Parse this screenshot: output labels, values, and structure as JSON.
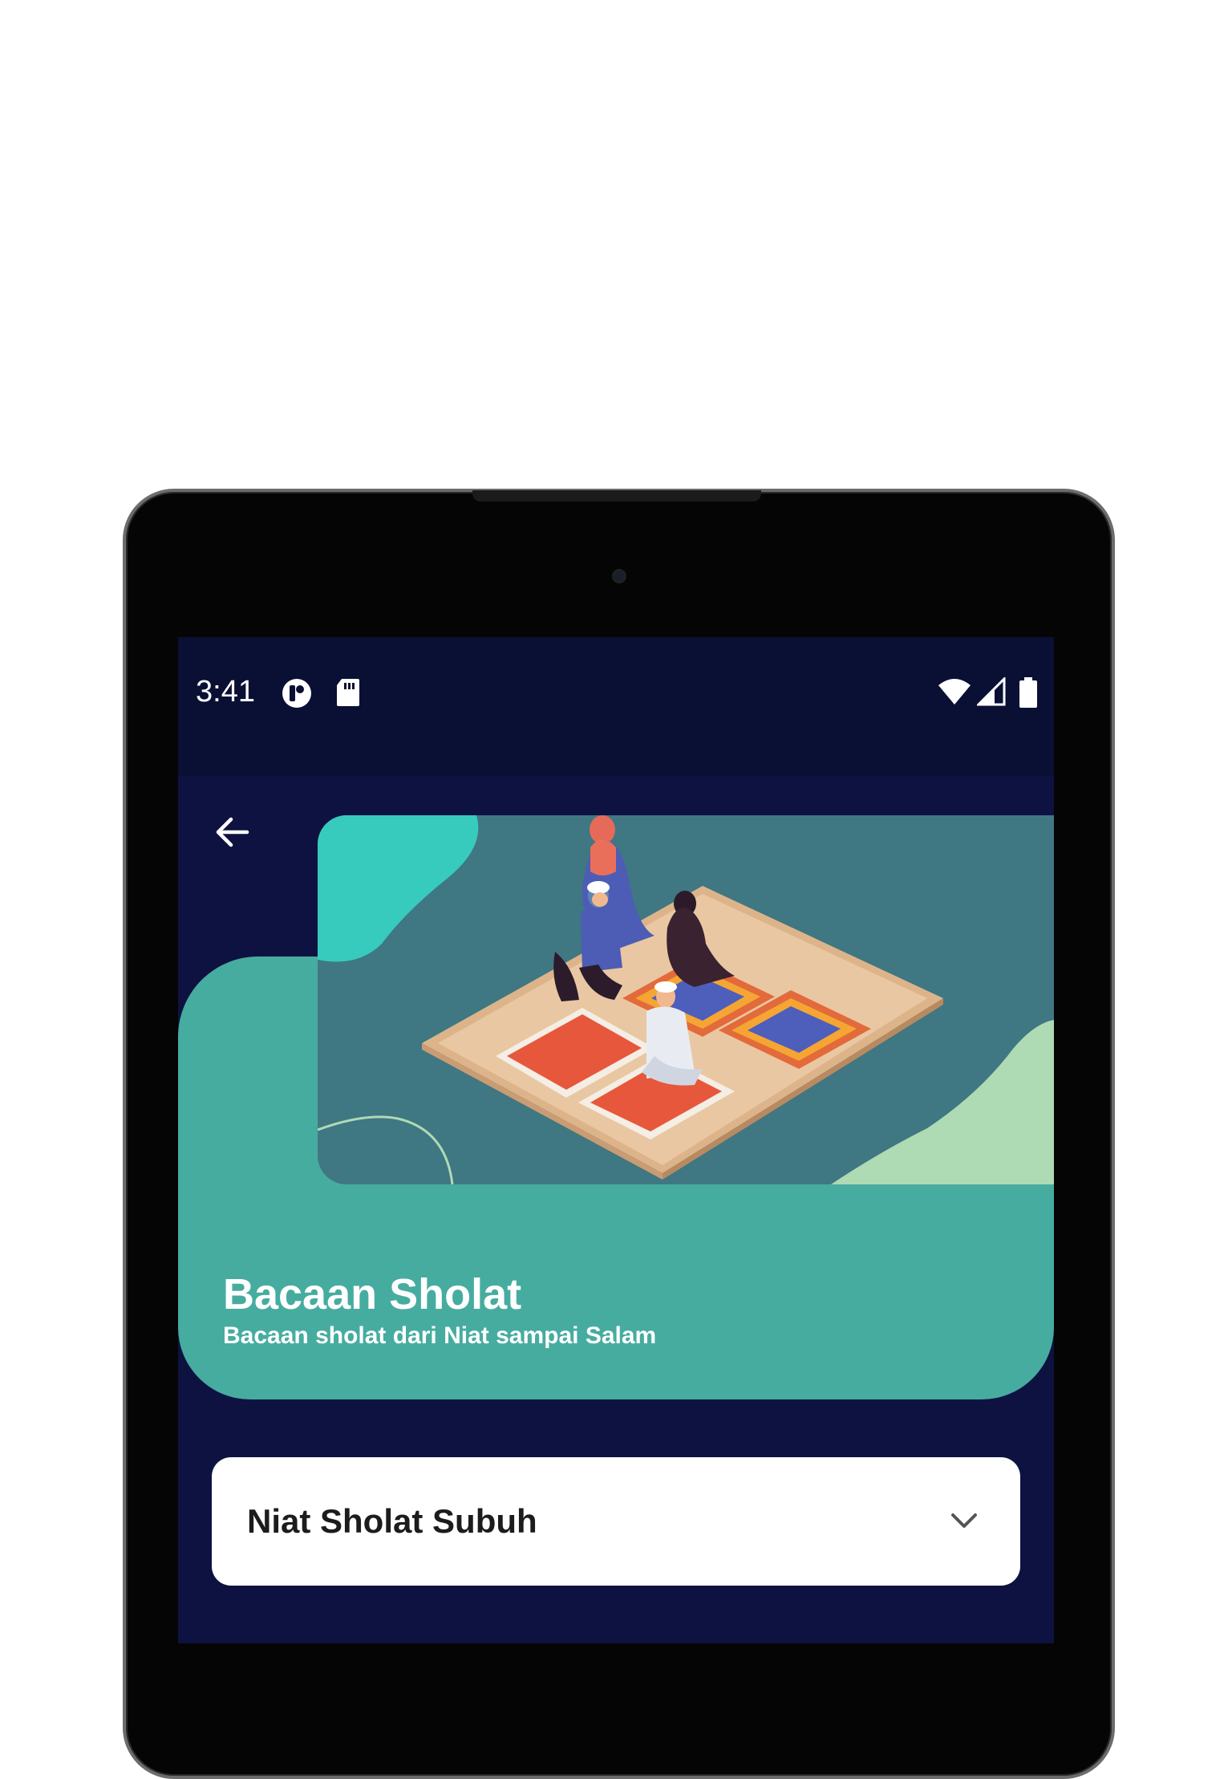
{
  "status_bar": {
    "time": "3:41",
    "icons": [
      "launcher-icon",
      "sd-card-icon",
      "wifi-icon",
      "signal-icon",
      "battery-icon"
    ]
  },
  "header": {
    "back_icon": "arrow-left-icon",
    "title": "Bacaan Sholat",
    "subtitle": "Bacaan sholat dari Niat sampai Salam"
  },
  "dropdown": {
    "selected": "Niat Sholat Subuh",
    "icon": "chevron-down-icon"
  },
  "colors": {
    "background": "#0e1241",
    "status_bar": "#0a1034",
    "hero": "#46aca0",
    "banner": "#3f7782",
    "accent_teal": "#37cbbd",
    "accent_green": "#aedab4"
  }
}
